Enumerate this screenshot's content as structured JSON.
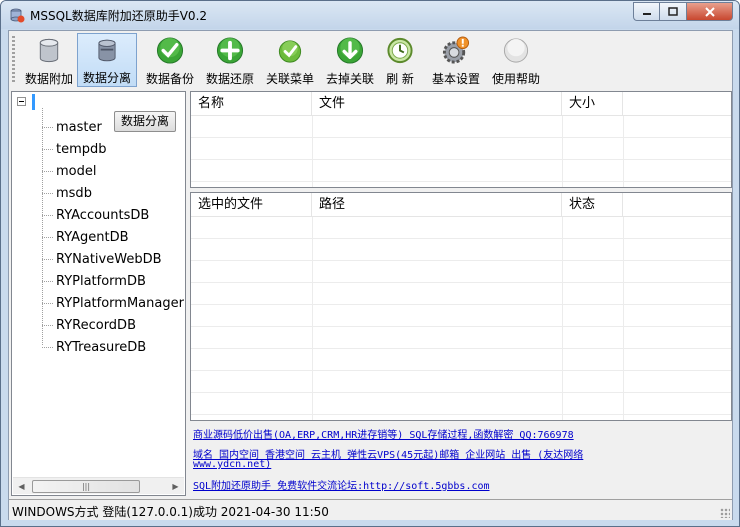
{
  "window": {
    "title": "MSSQL数据库附加还原助手V0.2"
  },
  "toolbar": {
    "buttons": [
      {
        "label": "数据附加",
        "icon": "database-attach-icon"
      },
      {
        "label": "数据分离",
        "icon": "database-detach-icon",
        "active": true
      },
      {
        "label": "数据备份",
        "icon": "green-check-icon"
      },
      {
        "label": "数据还原",
        "icon": "green-plus-icon"
      },
      {
        "label": "关联菜单",
        "icon": "small-check-icon"
      },
      {
        "label": "去掉关联",
        "icon": "green-down-arrow-icon"
      },
      {
        "label": "刷 新",
        "icon": "refresh-clock-icon"
      },
      {
        "label": "基本设置",
        "icon": "settings-gear-icon"
      },
      {
        "label": "使用帮助",
        "icon": "help-circle-icon"
      }
    ]
  },
  "tree": {
    "items": [
      "master",
      "tempdb",
      "model",
      "msdb",
      "RYAccountsDB",
      "RYAgentDB",
      "RYNativeWebDB",
      "RYPlatformDB",
      "RYPlatformManagerDB",
      "RYRecordDB",
      "RYTreasureDB"
    ],
    "context_button": "数据分离"
  },
  "files_grid": {
    "columns": [
      "名称",
      "文件",
      "大小"
    ]
  },
  "selected_grid": {
    "columns": [
      "选中的文件",
      "路径",
      "状态"
    ]
  },
  "links": [
    "商业源码低价出售(OA,ERP,CRM,HR进存销等) SQL存储过程,函数解密 QQ:766978",
    "域名 国内空间 香港空间 云主机 弹性云VPS(45元起)邮箱 企业网站 出售 (友达网络",
    "www.ydcn.net)",
    "SQL附加还原助手  免费软件交流论坛:http://soft.5gbbs.com"
  ],
  "status": {
    "text": "WINDOWS方式 登陆(127.0.0.1)成功 2021-04-30 11:50"
  },
  "colors": {
    "accent": "#3399ff",
    "link": "#0000cc",
    "green": "#3aa536"
  }
}
